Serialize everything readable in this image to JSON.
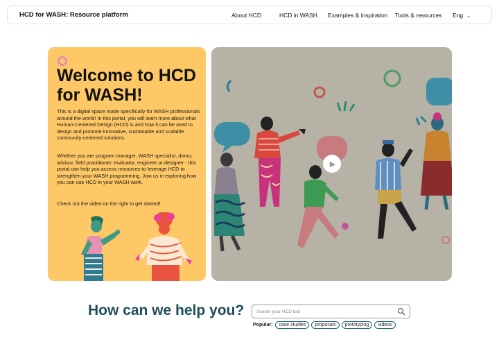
{
  "nav": {
    "brand": "HCD for WASH: Resource platform",
    "items": [
      "About HCD",
      "HCD in WASH",
      "Examples & inspiration",
      "Tools & resources"
    ],
    "language": "Eng"
  },
  "hero": {
    "title": "Welcome to HCD for WASH!",
    "paragraphs": [
      "This is a digital space made specifically for WASH professionals around the world! In this portal, you will learn more about what Human-Centered Design (HCD) is and how it can be used to design and promote innovative, sustainable and scalable community-centered solutions.",
      "Whether you are program manager, WASH specialist, donor, advisor, field practitioner, evaluator, engineer or designer - this portal can help you access resources to leverage HCD to strengthen your WASH programming. Join us in exploring how you can use HCD in your WASH work.",
      "Check out the video on the right to get started!"
    ]
  },
  "video": {
    "play_icon": "play-icon"
  },
  "help": {
    "title": "How can we help you?",
    "search_placeholder": "Search your HCD tool",
    "popular_label": "Popular:",
    "chips": [
      "case studies",
      "proposals",
      "prototyping",
      "videos"
    ]
  },
  "colors": {
    "hero_left_bg": "#fec867",
    "hero_right_bg": "#b6b2a5",
    "heading_teal": "#1d4d5a",
    "chip_border": "#1d6a77"
  }
}
